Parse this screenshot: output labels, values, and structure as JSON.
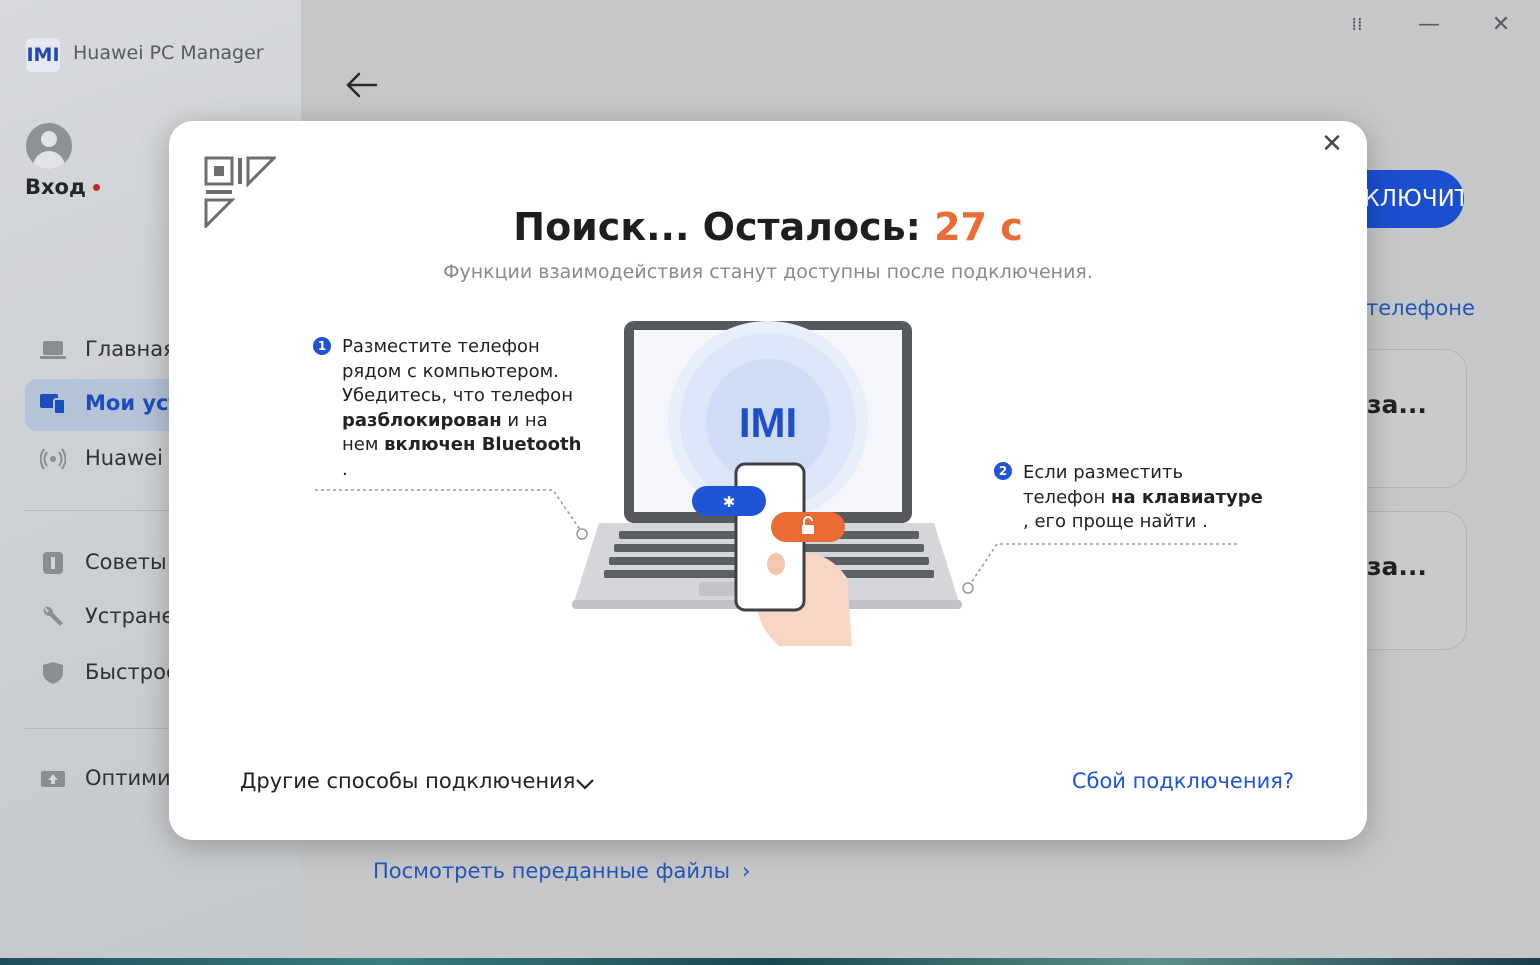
{
  "app": {
    "title": "Huawei PC Manager",
    "logo_text": "IMI"
  },
  "user": {
    "login_label": "Вход"
  },
  "sidebar": {
    "items": [
      {
        "label": "Главная",
        "icon": "laptop-icon"
      },
      {
        "label": "Мои устройства",
        "icon": "devices-icon",
        "active": true
      },
      {
        "label": "Huawei Share",
        "icon": "share-icon"
      },
      {
        "label": "Советы",
        "icon": "tips-icon"
      },
      {
        "label": "Устранение неполадок",
        "icon": "wrench-icon"
      },
      {
        "label": "Быстрое обслуживание",
        "icon": "shield-icon"
      },
      {
        "label": "Оптимизация",
        "icon": "optimize-icon"
      }
    ]
  },
  "window_controls": {
    "menu": "⁞⁞",
    "minimize": "—",
    "close": "✕"
  },
  "main": {
    "action_button": "ПОДКЛЮЧИТЬ",
    "phone_link": "телефоне",
    "card_1_title": "за...",
    "card_2_title": "за...",
    "files_link": "Посмотреть переданные файлы"
  },
  "modal": {
    "title_prefix": "Поиск... Осталось: ",
    "countdown": "27 с",
    "subtitle": "Функции взаимодействия станут доступны после подключения.",
    "step1": {
      "num": "1",
      "l1": "Разместите телефон",
      "l2": "рядом с компьютером.",
      "l3": "Убедитесь, что телефон",
      "b1": "разблокирован",
      "t1": " и на",
      "t2": "нем ",
      "b2": "включен Bluetooth",
      "end": "."
    },
    "step2": {
      "num": "2",
      "l1": "Если разместить",
      "t1": "телефон ",
      "b1": "на клавиатуре",
      "l3": ", его проще найти ."
    },
    "other_ways": "Другие способы подключения",
    "fail_link": "Сбой подключения?",
    "close": "✕"
  },
  "colors": {
    "accent": "#1f54d6",
    "countdown": "#ea6c34",
    "unlock_badge": "#ea6c34"
  }
}
